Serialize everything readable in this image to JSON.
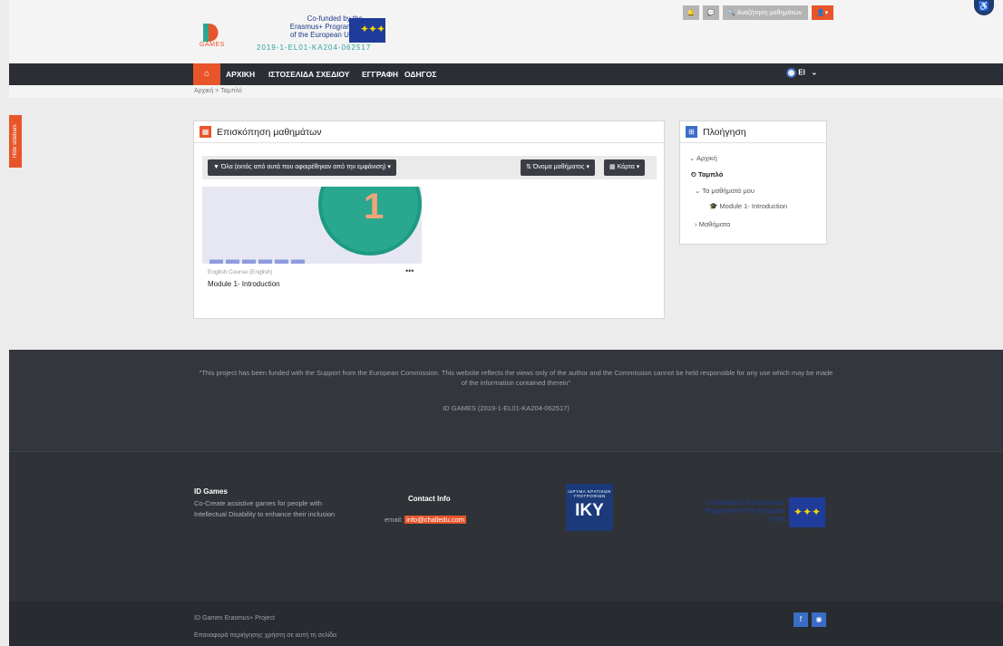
{
  "header": {
    "logo_text": "GAMES",
    "cofund_lines": [
      "Co-funded by the",
      "Erasmus+ Programme",
      "of the European Union"
    ],
    "project_code": "2019-1-EL01-KA204-062517",
    "search_label": "Αναζήτηση μαθημάτων",
    "user_caret": "▾"
  },
  "nav": {
    "items": [
      "ΑΡΧΙΚΗ",
      "ΙΣΤΟΣΕΛΙΔΑ ΣΧΕΔΙΟΥ",
      "ΕΓΓΡΑΦΗ",
      "ΟΔΗΓΟΣ"
    ],
    "lang": "El"
  },
  "breadcrumb": "Αρχική > Ταμπλό",
  "sidebar_toggle": "Hide sidebars",
  "overview": {
    "title": "Επισκόπηση μαθημάτων",
    "filter_label": "Όλα (εκτός από αυτά που αφαιρέθηκαν από την εμφάνιση) ▾",
    "sort_label": "Όνομα μαθήματος ▾",
    "view_label": "Κάρτα ▾",
    "course": {
      "category": "English Course (English)",
      "name": "Module 1- Introduction",
      "number": "1",
      "menu": "•••"
    }
  },
  "navigation": {
    "title": "Πλοήγηση",
    "items": [
      {
        "label": "Αρχική"
      },
      {
        "label": "Ταμπλό"
      },
      {
        "label": "Τα μαθήματά μου"
      },
      {
        "label": "Module 1- Introduction"
      },
      {
        "label": "Μαθήματα"
      }
    ]
  },
  "footer": {
    "disclaimer": "\"This project has been funded with the Support from the European Commission. This website reflects the views only of the author and the Commission cannot be held responsible for any use which may be made of the information contained therein\"",
    "code": "ID GAMES (2019-1-EL01-KA204-062517)",
    "about_title": "ID Games",
    "about_text": "Co-Create assistive games for people with Intellectual Disability to enhance their inclusion",
    "contact_title": "Contact Info",
    "email_label": "email:",
    "email": "info@challedu.com",
    "iky_small": "ΙΔΡΥΜΑ ΚΡΑΤΙΚΩΝ ΥΠΟΤΡΟΦΙΩΝ",
    "iky_big": "IKY",
    "eu_text": "Co-funded by the Erasmus+ Programme of the European Union",
    "bottom_line1": "ID Games Erasmus+ Project",
    "bottom_line2": "Επαναφορά περιήγησης χρήστη σε αυτή τη σελίδα"
  },
  "colors": {
    "accent": "#e8552b",
    "nav_bg": "#2b2e35",
    "footer_bg": "#33373d",
    "eu_blue": "#1f3c9b"
  }
}
